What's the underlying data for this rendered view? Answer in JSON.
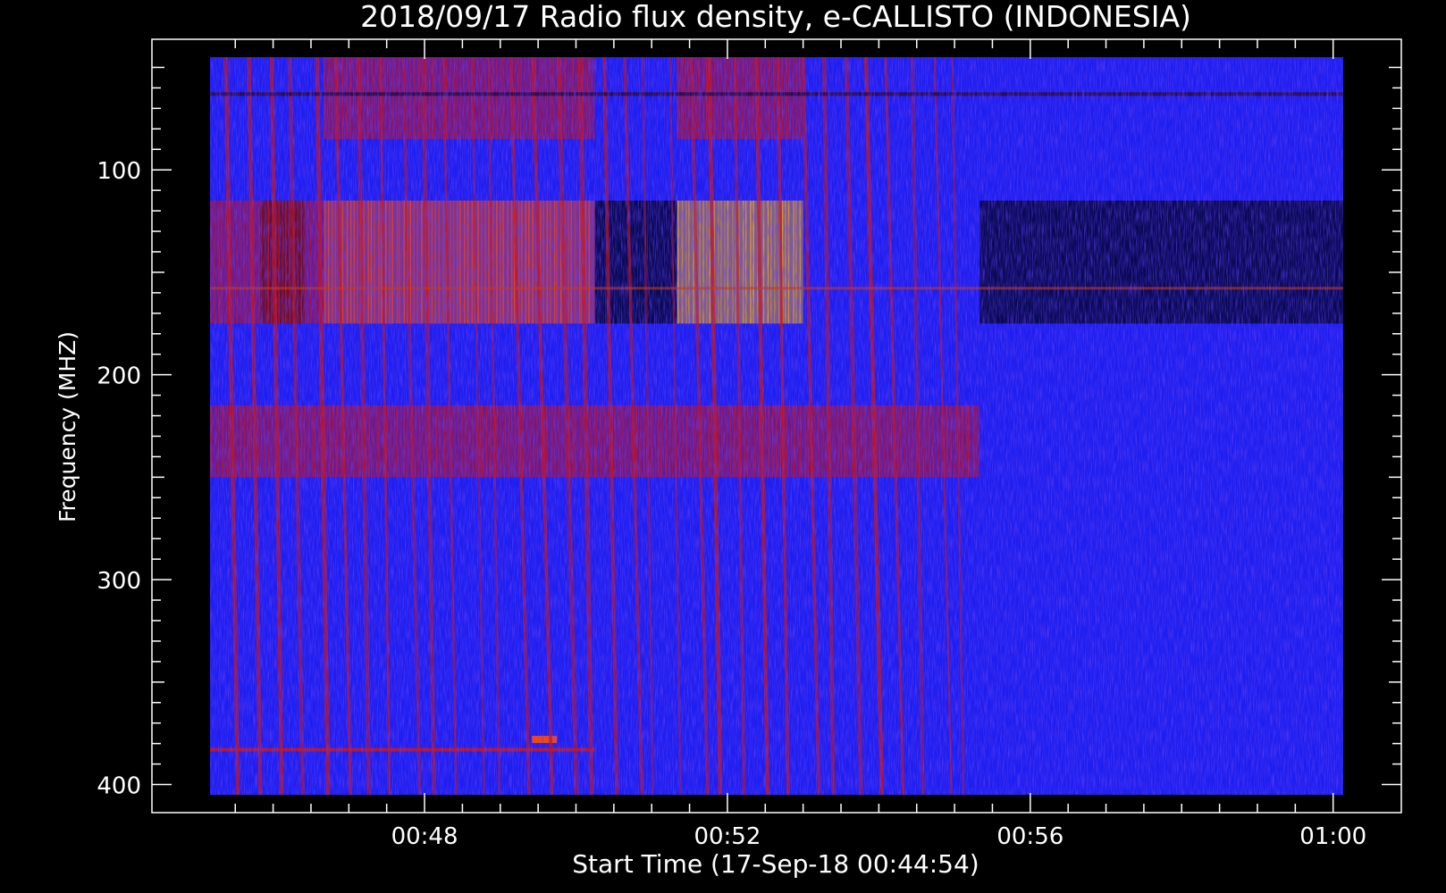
{
  "chart_data": {
    "type": "heatmap",
    "title": "2018/09/17  Radio flux density, e-CALLISTO (INDONESIA)",
    "xlabel": "Start Time (17-Sep-18 00:44:54)",
    "ylabel": "Frequency (MHZ)",
    "x_range": [
      "00:45:10",
      "01:00:08"
    ],
    "y_range_mhz": [
      45,
      405
    ],
    "y_axis_inverted": true,
    "x_ticks": [
      "00:48",
      "00:52",
      "00:56",
      "01:00"
    ],
    "y_ticks": [
      100,
      200,
      300,
      400
    ],
    "colormap": [
      "#000000",
      "#0000c8",
      "#2222ff",
      "#c81414",
      "#ff5a00",
      "#ffd000",
      "#ffffc0"
    ],
    "background_level": "blue",
    "bursts": [
      {
        "kind": "band",
        "t_start": "00:45:10",
        "t_end": "00:46:40",
        "f_low": 115,
        "f_high": 175,
        "level": "red"
      },
      {
        "kind": "band",
        "t_start": "00:46:40",
        "t_end": "00:50:15",
        "f_low": 115,
        "f_high": 175,
        "level": "orange"
      },
      {
        "kind": "band",
        "t_start": "00:51:20",
        "t_end": "00:53:00",
        "f_low": 115,
        "f_high": 175,
        "level": "yellow"
      },
      {
        "kind": "band",
        "t_start": "00:46:40",
        "t_end": "00:50:15",
        "f_low": 45,
        "f_high": 85,
        "level": "red"
      },
      {
        "kind": "band",
        "t_start": "00:51:20",
        "t_end": "00:53:00",
        "f_low": 45,
        "f_high": 85,
        "level": "red"
      },
      {
        "kind": "band",
        "t_start": "00:45:10",
        "t_end": "00:55:20",
        "f_low": 215,
        "f_high": 250,
        "level": "red"
      },
      {
        "kind": "line",
        "t_start": "00:45:10",
        "t_end": "00:50:15",
        "freq": 383,
        "level": "red"
      },
      {
        "kind": "spot",
        "time": "00:49:35",
        "freq": 378,
        "level": "orange"
      }
    ],
    "quiet_bands": [
      {
        "t_start": "00:50:15",
        "t_end": "00:51:20",
        "f_low": 115,
        "f_high": 175
      },
      {
        "t_start": "00:55:20",
        "t_end": "01:00:08",
        "f_low": 115,
        "f_high": 175
      },
      {
        "t_start": "00:45:50",
        "t_end": "00:46:25",
        "f_low": 115,
        "f_high": 175
      }
    ],
    "type_iii_drifts": {
      "t_start": "00:45:20",
      "t_end": "00:55:15",
      "count": 34,
      "f_low": 45,
      "f_high": 405,
      "level": "red"
    },
    "grid": false,
    "legend": "none"
  }
}
